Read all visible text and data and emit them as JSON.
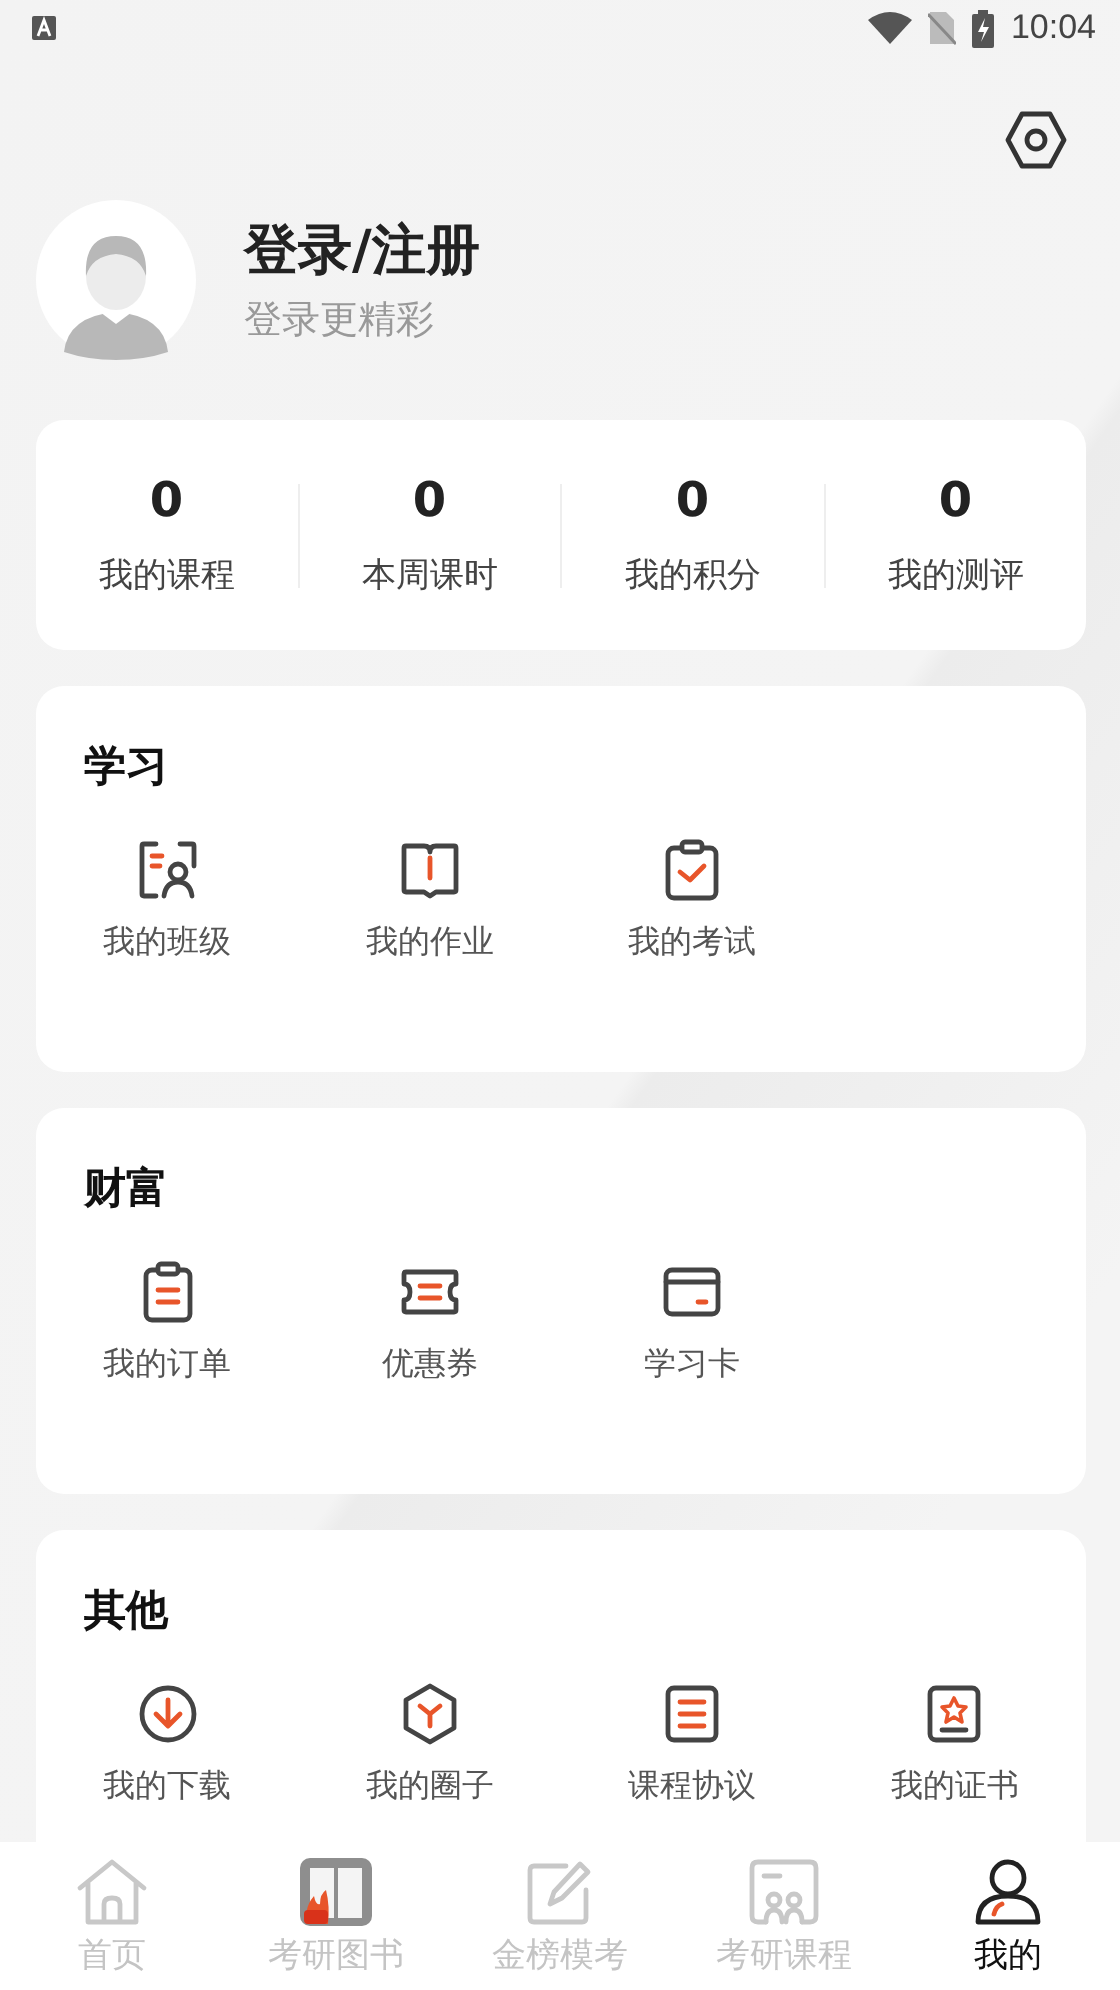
{
  "status_bar": {
    "time": "10:04"
  },
  "profile": {
    "name": "登录/注册",
    "subtitle": "登录更精彩"
  },
  "stats": [
    {
      "value": "0",
      "label": "我的课程"
    },
    {
      "value": "0",
      "label": "本周课时"
    },
    {
      "value": "0",
      "label": "我的积分"
    },
    {
      "value": "0",
      "label": "我的测评"
    }
  ],
  "sections": [
    {
      "title": "学习",
      "items": [
        {
          "label": "我的班级"
        },
        {
          "label": "我的作业"
        },
        {
          "label": "我的考试"
        }
      ]
    },
    {
      "title": "财富",
      "items": [
        {
          "label": "我的订单"
        },
        {
          "label": "优惠券"
        },
        {
          "label": "学习卡"
        }
      ]
    },
    {
      "title": "其他",
      "items": [
        {
          "label": "我的下载"
        },
        {
          "label": "我的圈子"
        },
        {
          "label": "课程协议"
        },
        {
          "label": "我的证书"
        }
      ]
    }
  ],
  "tabs": [
    {
      "label": "首页",
      "selected": false
    },
    {
      "label": "考研图书",
      "selected": false
    },
    {
      "label": "金榜模考",
      "selected": false
    },
    {
      "label": "考研课程",
      "selected": false
    },
    {
      "label": "我的",
      "selected": true
    }
  ]
}
